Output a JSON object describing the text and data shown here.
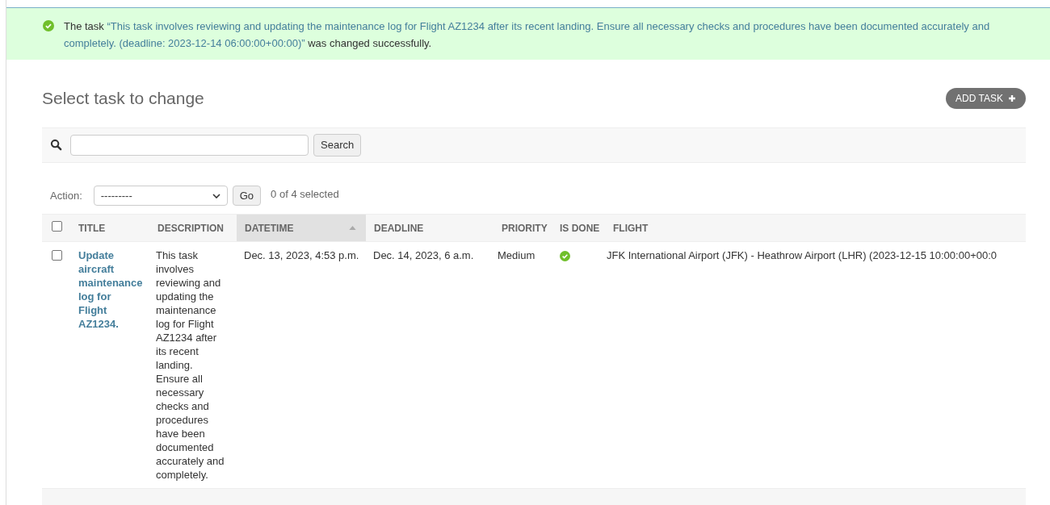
{
  "message": {
    "prefix": "The task",
    "quoted": "“This task involves reviewing and updating the maintenance log for Flight AZ1234 after its recent landing. Ensure all necessary checks and procedures have been documented accurately and completely. (deadline: 2023-12-14 06:00:00+00:00)”",
    "suffix": "was changed successfully."
  },
  "title": "Select task to change",
  "add_button": {
    "label": "ADD TASK"
  },
  "search": {
    "button": "Search"
  },
  "actions": {
    "label": "Action:",
    "value": "---------",
    "go": "Go",
    "counter": "0 of 4 selected"
  },
  "table": {
    "select_all": {
      "checked": false
    },
    "columns": [
      {
        "label": "TITLE",
        "sorted": false
      },
      {
        "label": "DESCRIPTION",
        "sorted": false
      },
      {
        "label": "DATETIME",
        "sorted": true
      },
      {
        "label": "DEADLINE",
        "sorted": false
      },
      {
        "label": "PRIORITY",
        "sorted": false
      },
      {
        "label": "IS DONE",
        "sorted": false
      },
      {
        "label": "FLIGHT",
        "sorted": false
      }
    ],
    "rows": [
      {
        "checked": false,
        "title": "Update aircraft maintenance log for Flight AZ1234.",
        "description": "This task involves reviewing and updating the maintenance log for Flight AZ1234 after its recent landing. Ensure all necessary checks and procedures have been documented accurately and completely.",
        "datetime": "Dec. 13, 2023, 4:53 p.m.",
        "deadline": "Dec. 14, 2023, 6 a.m.",
        "priority": "Medium",
        "is_done": true,
        "flight": "JFK International Airport (JFK) - Heathrow Airport (LHR) (2023-12-15 10:00:00+00:0"
      }
    ]
  }
}
